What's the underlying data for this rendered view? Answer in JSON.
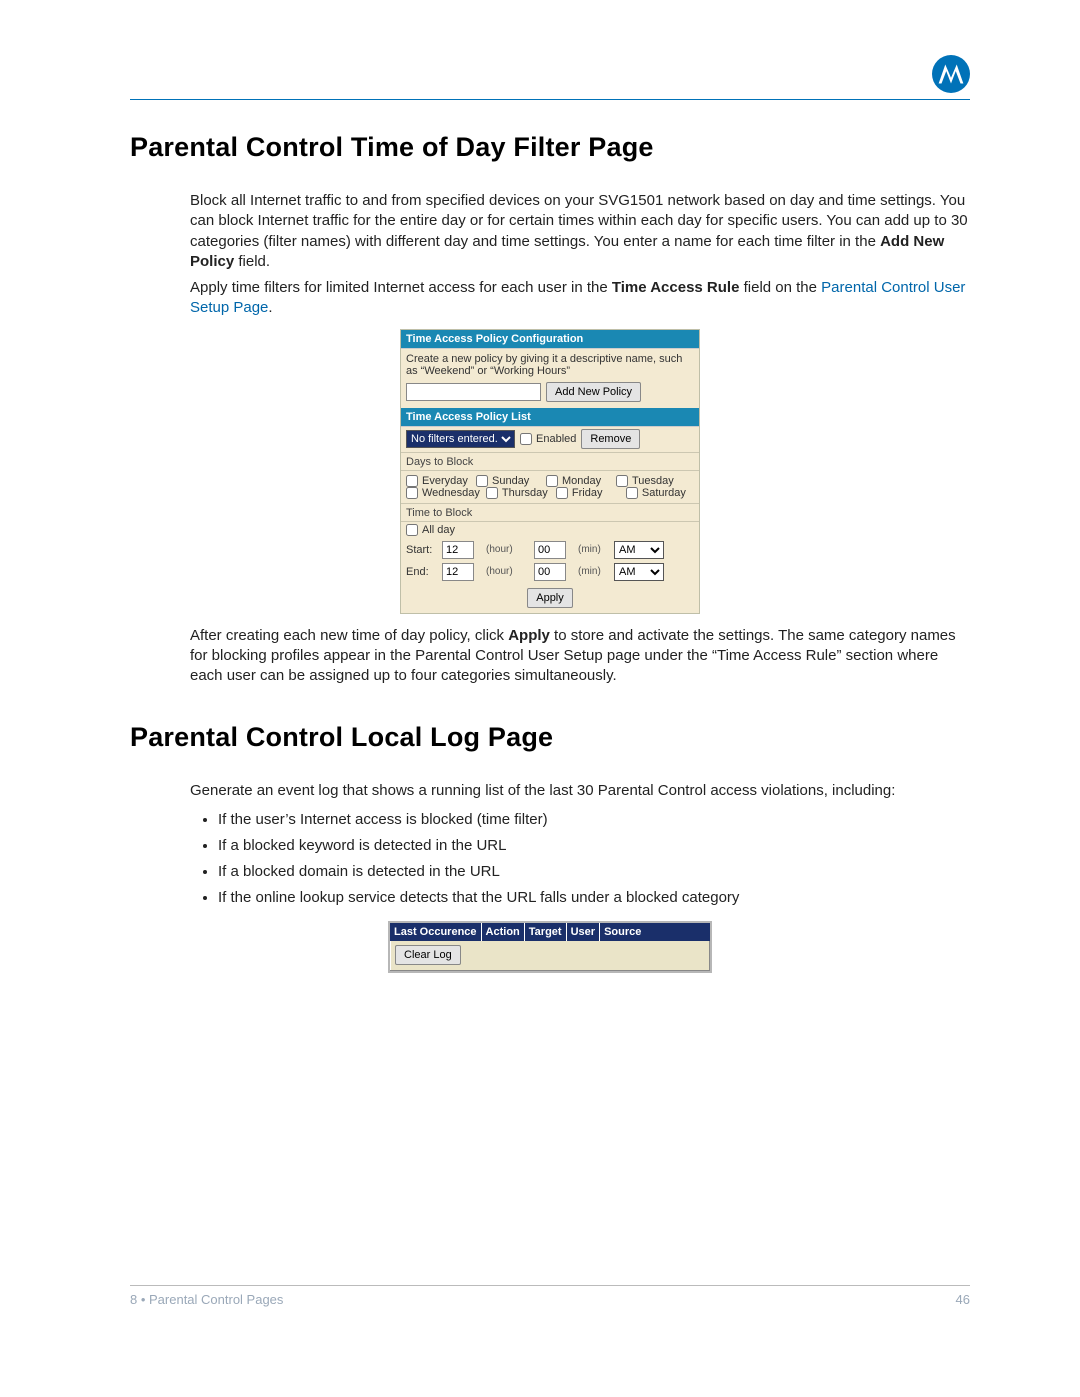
{
  "header": {
    "logo_name": "motorola-logo"
  },
  "sections": {
    "tod": {
      "title": "Parental Control Time of Day Filter Page",
      "p1a": "Block all Internet traffic to and from specified devices on your SVG1501 network based on day and time settings. You can block Internet traffic for the entire day or for certain times within each day for specific users. You can add up to 30 categories (filter names) with different day and time settings. You enter a name for each time filter in the ",
      "p1b_bold": "Add New Policy",
      "p1c": " field.",
      "p2a": "Apply time filters for limited Internet access for each user in the ",
      "p2b_bold": "Time Access Rule",
      "p2c": " field on the ",
      "p2d_link": "Parental Control User Setup Page",
      "p2e": ".",
      "p3a": "After creating each new time of day policy, click ",
      "p3b_bold": "Apply",
      "p3c": " to store and activate the settings. The same category names for blocking profiles appear in the Parental Control User Setup page under the “Time Access Rule” section where each user can be assigned up to four categories simultaneously."
    },
    "log": {
      "title": "Parental Control Local Log Page",
      "intro": "Generate an event log that shows a running list of the last 30 Parental Control access violations, including:",
      "bullets": [
        "If the user’s Internet access is blocked (time filter)",
        "If a blocked keyword is detected in the URL",
        "If a blocked domain is detected in the URL",
        "If the online lookup service detects that the URL falls under a blocked category"
      ]
    }
  },
  "panel": {
    "hdr_config": "Time Access Policy Configuration",
    "config_hint": "Create a new policy by giving it a descriptive name, such as “Weekend” or “Working Hours”",
    "add_btn": "Add New Policy",
    "hdr_list": "Time Access Policy List",
    "filter_select": "No filters entered.",
    "enabled_label": "Enabled",
    "remove_btn": "Remove",
    "days_label": "Days to Block",
    "days": [
      "Everyday",
      "Sunday",
      "Monday",
      "Tuesday",
      "Wednesday",
      "Thursday",
      "Friday",
      "Saturday"
    ],
    "time_label": "Time to Block",
    "allday_label": "All day",
    "start_label": "Start:",
    "end_label": "End:",
    "start_hour": "12",
    "start_min": "00",
    "end_hour": "12",
    "end_min": "00",
    "hour_unit": "(hour)",
    "min_unit": "(min)",
    "ampm": "AM",
    "apply_btn": "Apply"
  },
  "log_table": {
    "cols": [
      "Last Occurence",
      "Action",
      "Target",
      "User",
      "Source"
    ],
    "clear_btn": "Clear Log"
  },
  "footer": {
    "left": "8 • Parental Control Pages",
    "right": "46"
  }
}
